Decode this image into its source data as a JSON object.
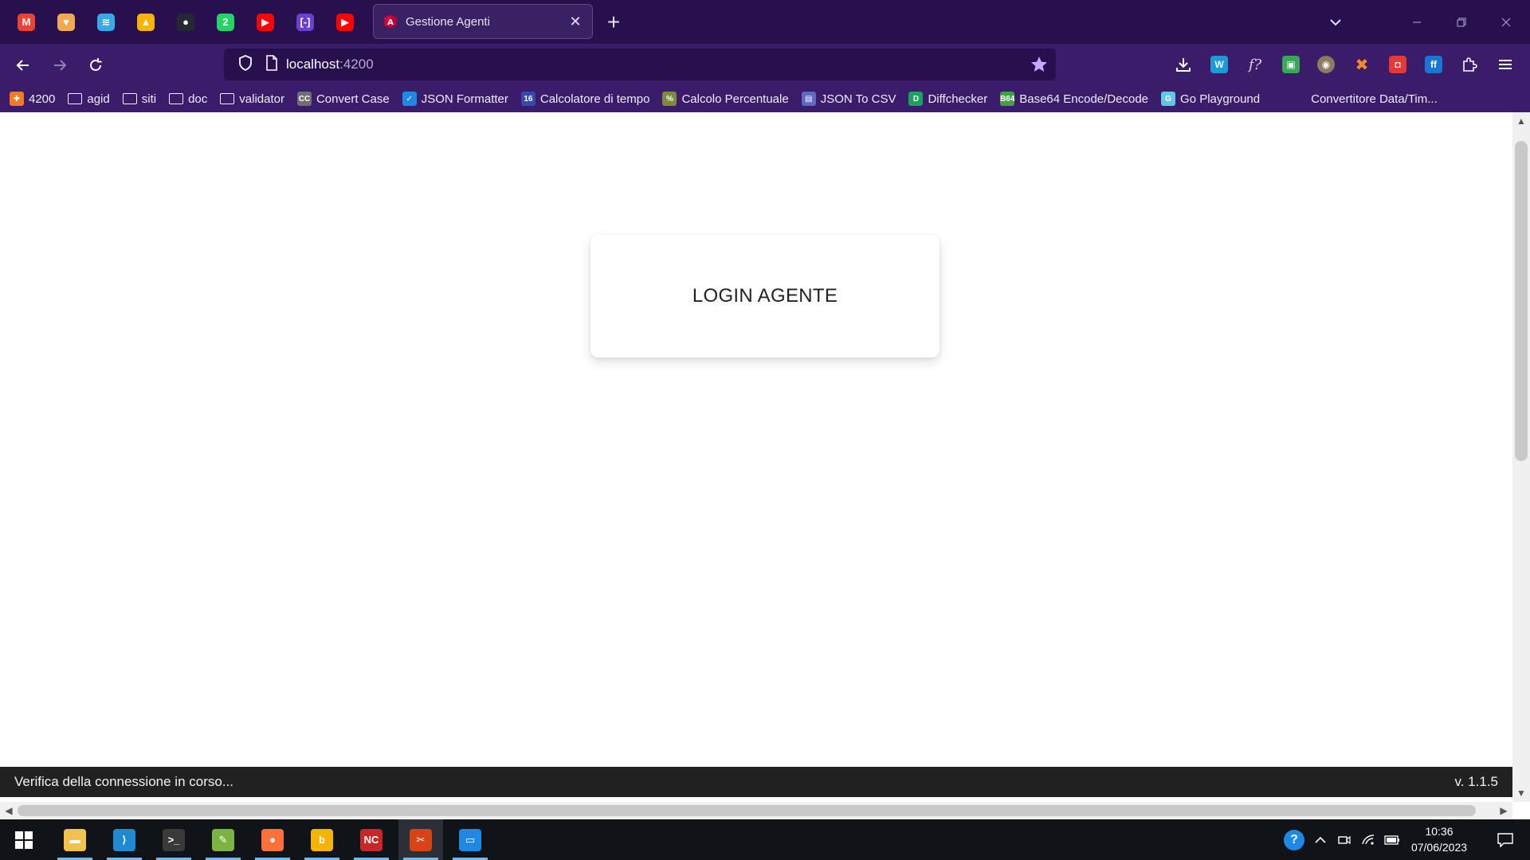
{
  "browser": {
    "pinned_tabs": [
      {
        "icon": "gmail-icon",
        "glyph": "M",
        "color": "#ea4335"
      },
      {
        "icon": "pocket-icon",
        "glyph": "♥",
        "color": "#f3aa4e"
      },
      {
        "icon": "stack-icon",
        "glyph": "≋",
        "color": "#3aa7e8"
      },
      {
        "icon": "drive-icon",
        "glyph": "▲",
        "color": "#f4b400"
      },
      {
        "icon": "github-icon",
        "glyph": "●",
        "color": "#24292f"
      },
      {
        "icon": "whatsapp-icon",
        "glyph": "2",
        "color": "#25d366"
      },
      {
        "icon": "youtube-icon",
        "glyph": "▶",
        "color": "#ff0000"
      },
      {
        "icon": "brackets-icon",
        "glyph": "[-]",
        "color": "#6a3fd1"
      },
      {
        "icon": "youtube-icon",
        "glyph": "▶",
        "color": "#ff0000"
      }
    ],
    "active_tab": {
      "title": "Gestione Agenti",
      "favicon": "angular-icon",
      "accent": "#dd0031"
    },
    "url": {
      "host": "localhost",
      "port": ":4200"
    },
    "bookmarks": [
      {
        "label": "4200",
        "type": "site",
        "color": "#f47b20",
        "glyph": "✚"
      },
      {
        "label": "agid",
        "type": "folder"
      },
      {
        "label": "siti",
        "type": "folder"
      },
      {
        "label": "doc",
        "type": "folder"
      },
      {
        "label": "validator",
        "type": "folder"
      },
      {
        "label": "Convert Case",
        "type": "site",
        "color": "#6f6f6f",
        "glyph": "CC"
      },
      {
        "label": "JSON Formatter",
        "type": "site",
        "color": "#1e88e5",
        "glyph": "✓"
      },
      {
        "label": "Calcolatore di tempo",
        "type": "site",
        "color": "#3949ab",
        "glyph": "16"
      },
      {
        "label": "Calcolo Percentuale",
        "type": "site",
        "color": "#7a8b3a",
        "glyph": "%"
      },
      {
        "label": "JSON To CSV",
        "type": "site",
        "color": "#5c6bc0",
        "glyph": "▤"
      },
      {
        "label": "Diffchecker",
        "type": "site",
        "color": "#1aa260",
        "glyph": "D"
      },
      {
        "label": "Base64 Encode/Decode",
        "type": "site",
        "color": "#43a047",
        "glyph": "B64"
      },
      {
        "label": "Go Playground",
        "type": "site",
        "color": "#5dc9e2",
        "glyph": "G"
      },
      {
        "label": "Convertitore Data/Tim...",
        "type": "site",
        "color": "#3b1c6a",
        "glyph": ""
      }
    ]
  },
  "page": {
    "card_title": "LOGIN AGENTE",
    "footer_status": "Verifica della connessione in corso...",
    "footer_version": "v. 1.1.5"
  },
  "taskbar": {
    "apps": [
      {
        "name": "file-explorer-icon",
        "glyph": "▬",
        "color": "#f2c14e"
      },
      {
        "name": "vscode-icon",
        "glyph": "⟩",
        "color": "#1f8ad2"
      },
      {
        "name": "terminal-icon",
        "glyph": ">_",
        "color": "#3a3a3a"
      },
      {
        "name": "notepad-plus-icon",
        "glyph": "✎",
        "color": "#7cb342"
      },
      {
        "name": "firefox-icon",
        "glyph": "●",
        "color": "#ff7139"
      },
      {
        "name": "bing-icon",
        "glyph": "b",
        "color": "#f5b400"
      },
      {
        "name": "nac-icon",
        "glyph": "NC",
        "color": "#c62828"
      },
      {
        "name": "paint-icon",
        "glyph": "✂",
        "color": "#d84315"
      },
      {
        "name": "window-icon",
        "glyph": "▭",
        "color": "#1e88e5"
      }
    ],
    "time": "10:36",
    "date": "07/06/2023"
  }
}
